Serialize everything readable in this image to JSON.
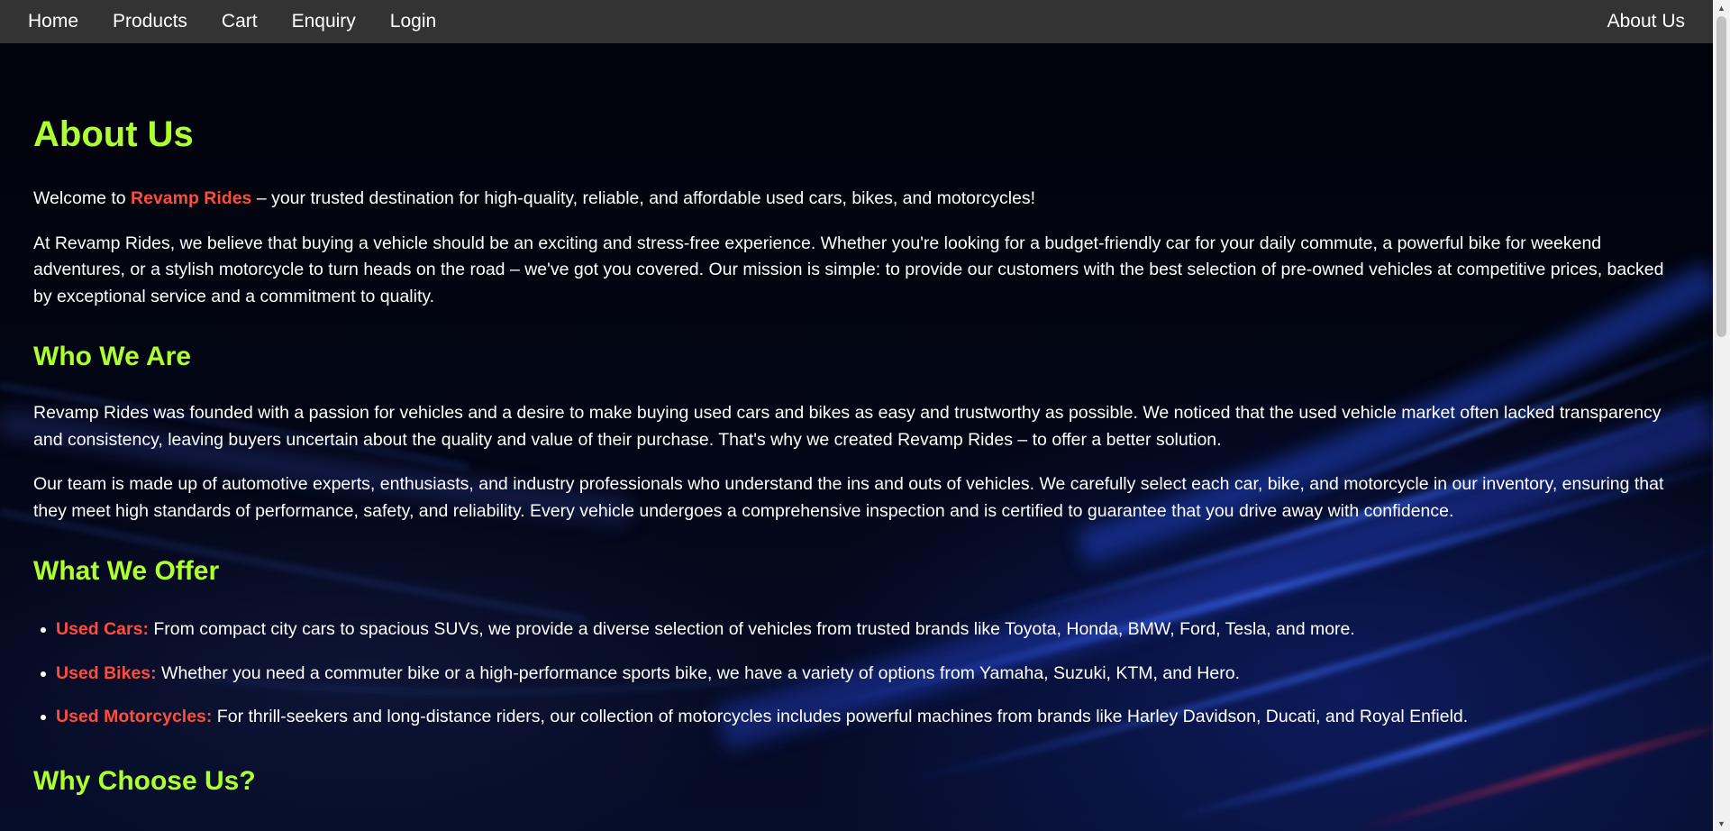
{
  "nav": {
    "links": [
      "Home",
      "Products",
      "Cart",
      "Enquiry",
      "Login"
    ],
    "right_link": "About Us"
  },
  "page": {
    "title": "About Us",
    "welcome": {
      "before": "Welcome to ",
      "brand": "Revamp Rides",
      "after": " – your trusted destination for high-quality, reliable, and affordable used cars, bikes, and motorcycles!"
    },
    "intro": "At Revamp Rides, we believe that buying a vehicle should be an exciting and stress-free experience. Whether you're looking for a budget-friendly car for your daily commute, a powerful bike for weekend adventures, or a stylish motorcycle to turn heads on the road – we've got you covered. Our mission is simple: to provide our customers with the best selection of pre-owned vehicles at competitive prices, backed by exceptional service and a commitment to quality.",
    "who": {
      "heading": "Who We Are",
      "p1": "Revamp Rides was founded with a passion for vehicles and a desire to make buying used cars and bikes as easy and trustworthy as possible. We noticed that the used vehicle market often lacked transparency and consistency, leaving buyers uncertain about the quality and value of their purchase. That's why we created Revamp Rides – to offer a better solution.",
      "p2": "Our team is made up of automotive experts, enthusiasts, and industry professionals who understand the ins and outs of vehicles. We carefully select each car, bike, and motorcycle in our inventory, ensuring that they meet high standards of performance, safety, and reliability. Every vehicle undergoes a comprehensive inspection and is certified to guarantee that you drive away with confidence."
    },
    "offer": {
      "heading": "What We Offer",
      "items": [
        {
          "label": "Used Cars:",
          "text": " From compact city cars to spacious SUVs, we provide a diverse selection of vehicles from trusted brands like Toyota, Honda, BMW, Ford, Tesla, and more."
        },
        {
          "label": "Used Bikes:",
          "text": " Whether you need a commuter bike or a high-performance sports bike, we have a variety of options from Yamaha, Suzuki, KTM, and Hero."
        },
        {
          "label": "Used Motorcycles:",
          "text": " For thrill-seekers and long-distance riders, our collection of motorcycles includes powerful machines from brands like Harley Davidson, Ducati, and Royal Enfield."
        }
      ]
    },
    "why": {
      "heading": "Why Choose Us?"
    }
  },
  "colors": {
    "heading": "#adff2f",
    "accent": "#ff4d3a",
    "navbar": "#333333",
    "background": "#01020a"
  },
  "icons": {
    "scroll_up": "chevron-up-icon",
    "scroll_down": "chevron-down-icon"
  }
}
